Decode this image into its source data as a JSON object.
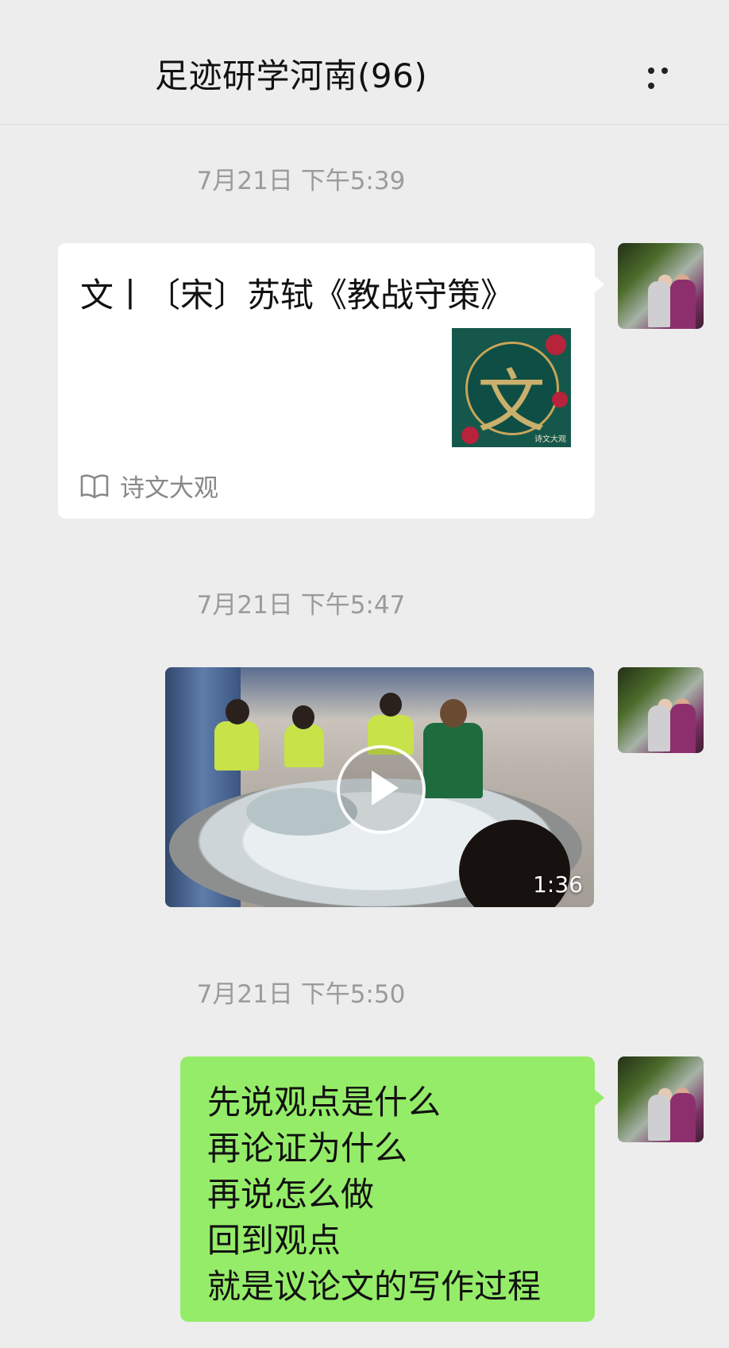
{
  "header": {
    "title": "足迹研学河南(96)",
    "more_icon": "more-dots-icon"
  },
  "messages": [
    {
      "timestamp": "7月21日 下午5:39",
      "type": "link",
      "title": "文丨〔宋〕苏轼《教战守策》",
      "thumb_glyph": "文",
      "thumb_brand": "诗文大观",
      "source": "诗文大观",
      "source_icon": "book-icon"
    },
    {
      "timestamp": "7月21日 下午5:47",
      "type": "video",
      "duration": "1:36",
      "play_icon": "play-icon"
    },
    {
      "timestamp": "7月21日 下午5:50",
      "type": "text",
      "lines": [
        "先说观点是什么",
        "再论证为什么",
        "再说怎么做",
        "回到观点",
        "就是议论文的写作过程"
      ]
    }
  ],
  "colors": {
    "background": "#ededed",
    "self_bubble": "#95ec69",
    "card": "#ffffff",
    "timestamp": "#9b9b9b"
  }
}
